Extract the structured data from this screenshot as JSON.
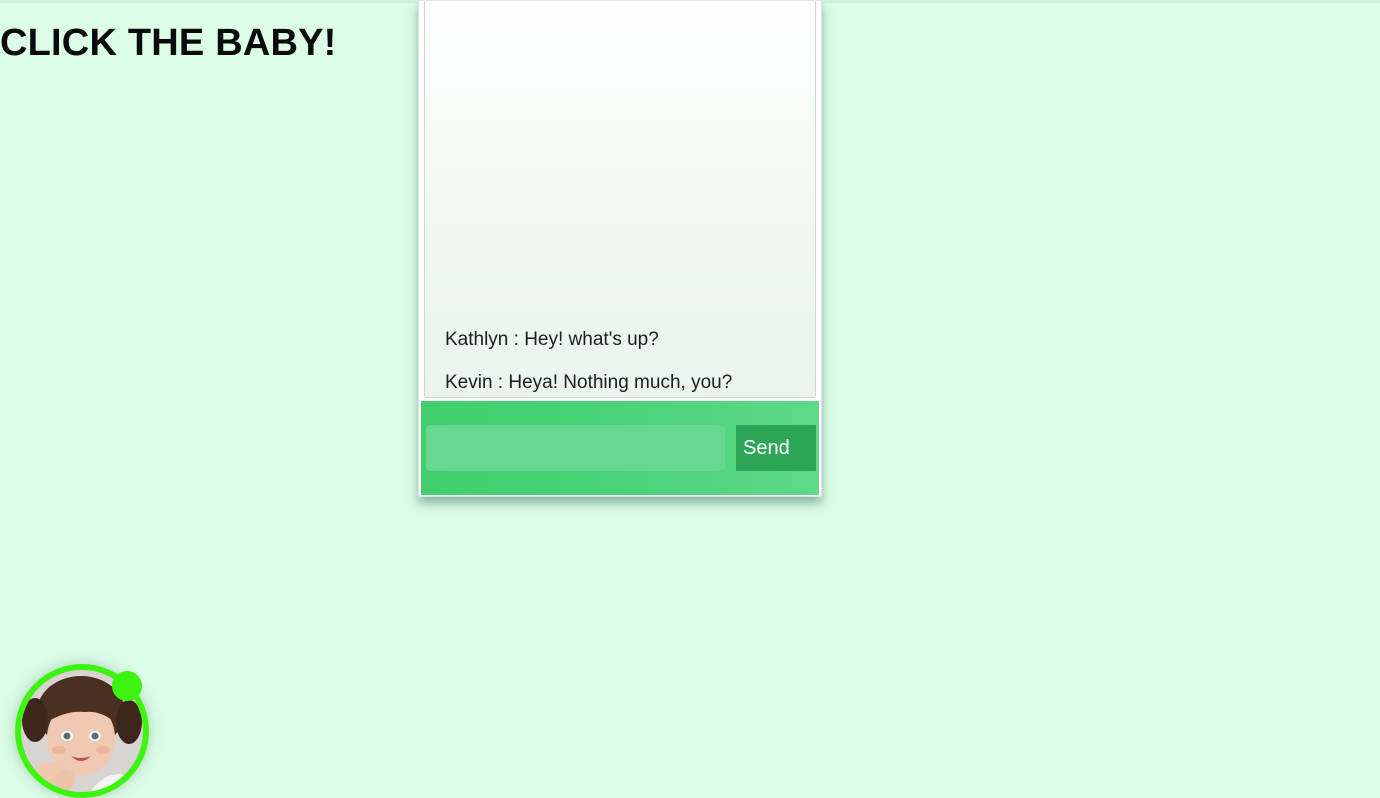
{
  "page": {
    "heading": "CLICK THE BABY!"
  },
  "chat": {
    "messages": [
      {
        "text": "Kathlyn : Hey! what's up?"
      },
      {
        "text": "Kevin : Heya! Nothing much, you?"
      }
    ],
    "input_value": "",
    "send_label": "Send"
  },
  "launcher": {
    "avatar_alt": "baby-avatar",
    "status": "online",
    "ring_color": "#3df40f",
    "status_dot_color": "#3df40f"
  },
  "colors": {
    "background": "#dcfde6",
    "input_bar": "#4bd37a",
    "send_button": "#2ea657"
  }
}
